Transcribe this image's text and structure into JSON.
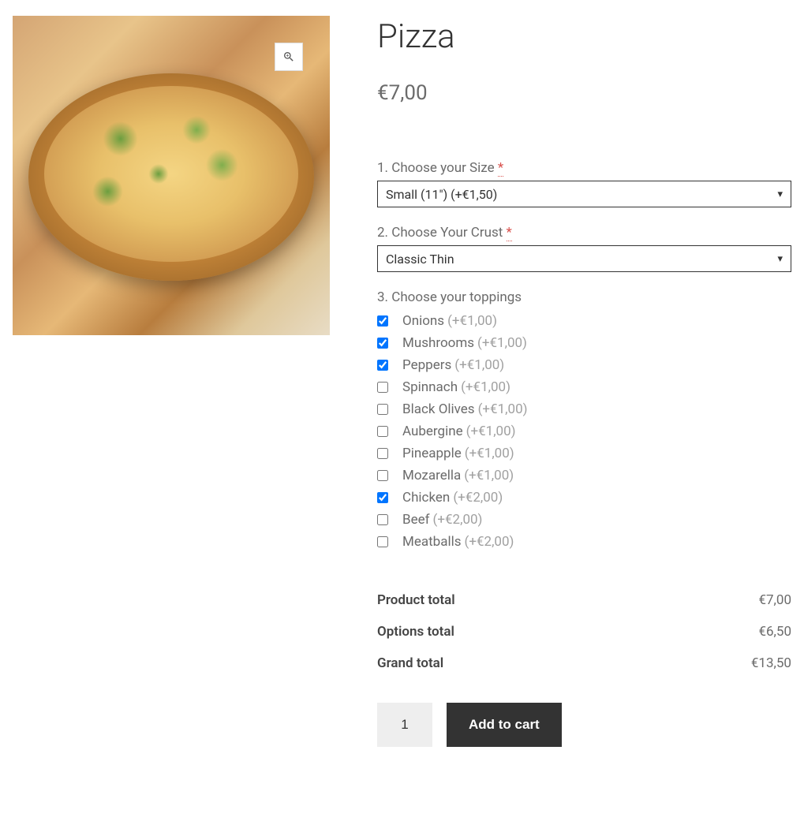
{
  "product": {
    "title": "Pizza",
    "price": "€7,00"
  },
  "options": {
    "size": {
      "label": "1. Choose your Size",
      "required": "*",
      "selected": "Small (11\") (+€1,50)"
    },
    "crust": {
      "label": "2. Choose Your Crust",
      "required": "*",
      "selected": "Classic Thin"
    },
    "toppings": {
      "label": "3. Choose your toppings",
      "items": [
        {
          "name": "Onions",
          "price": "(+€1,00)",
          "checked": true
        },
        {
          "name": "Mushrooms",
          "price": "(+€1,00)",
          "checked": true
        },
        {
          "name": "Peppers",
          "price": "(+€1,00)",
          "checked": true
        },
        {
          "name": "Spinnach",
          "price": "(+€1,00)",
          "checked": false
        },
        {
          "name": "Black Olives",
          "price": "(+€1,00)",
          "checked": false
        },
        {
          "name": "Aubergine",
          "price": "(+€1,00)",
          "checked": false
        },
        {
          "name": "Pineapple",
          "price": "(+€1,00)",
          "checked": false
        },
        {
          "name": "Mozarella",
          "price": "(+€1,00)",
          "checked": false
        },
        {
          "name": "Chicken",
          "price": "(+€2,00)",
          "checked": true
        },
        {
          "name": "Beef",
          "price": "(+€2,00)",
          "checked": false
        },
        {
          "name": "Meatballs",
          "price": "(+€2,00)",
          "checked": false
        }
      ]
    }
  },
  "totals": {
    "product_label": "Product total",
    "product_value": "€7,00",
    "options_label": "Options total",
    "options_value": "€6,50",
    "grand_label": "Grand total",
    "grand_value": "€13,50"
  },
  "actions": {
    "quantity": "1",
    "add_label": "Add to cart"
  }
}
